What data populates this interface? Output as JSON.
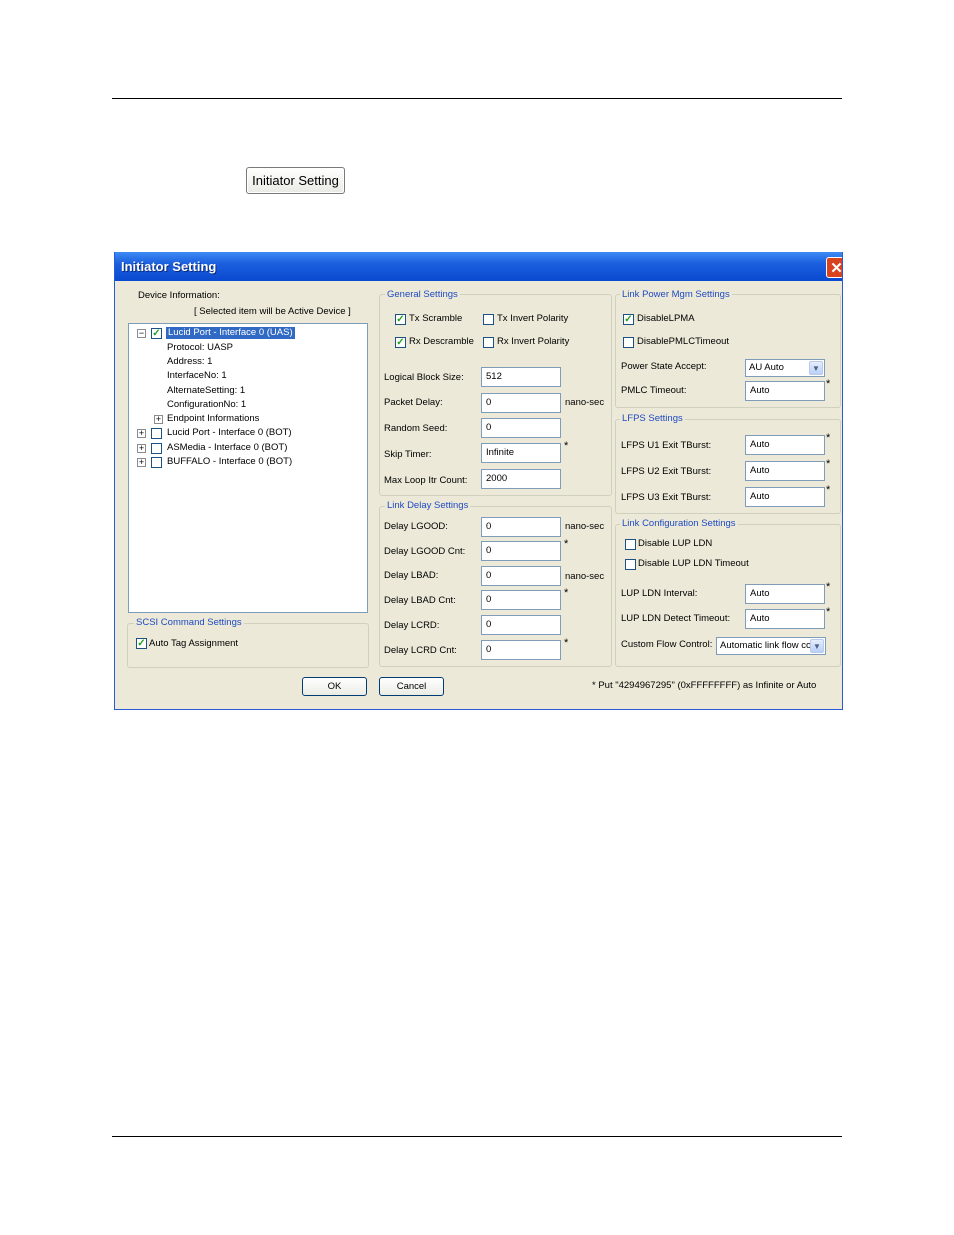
{
  "page_button": "Initiator Setting",
  "dialog": {
    "title": "Initiator Setting",
    "close_icon": "close-icon",
    "device_info": {
      "label": "Device Information:",
      "hint": "[ Selected item will be Active Device  ]",
      "tree": {
        "root": "Lucid Port - Interface 0 (UAS)",
        "children": [
          "Protocol: UASP",
          "Address: 1",
          "InterfaceNo: 1",
          "AlternateSetting: 1",
          "ConfigurationNo: 1",
          "Endpoint Informations"
        ],
        "others": [
          "Lucid Port - Interface 0 (BOT)",
          "ASMedia - Interface 0 (BOT)",
          "BUFFALO - Interface 0 (BOT)"
        ]
      }
    },
    "scsi": {
      "title": "SCSI Command Settings",
      "auto_tag": "Auto Tag Assignment"
    },
    "general": {
      "title": "General Settings",
      "tx_scramble": "Tx Scramble",
      "tx_invert": "Tx Invert Polarity",
      "rx_descramble": "Rx Descramble",
      "rx_invert": "Rx Invert Polarity",
      "logical_block_label": "Logical Block Size:",
      "logical_block_value": "512",
      "packet_delay_label": "Packet Delay:",
      "packet_delay_value": "0",
      "packet_delay_unit": "nano-sec",
      "random_seed_label": "Random Seed:",
      "random_seed_value": "0",
      "skip_timer_label": "Skip Timer:",
      "skip_timer_value": "Infinite",
      "max_loop_label": "Max Loop Itr Count:",
      "max_loop_value": "2000"
    },
    "link_delay": {
      "title": "Link Delay Settings",
      "lgood_label": "Delay LGOOD:",
      "lgood_value": "0",
      "lgood_unit": "nano-sec",
      "lgood_cnt_label": "Delay LGOOD Cnt:",
      "lgood_cnt_value": "0",
      "lbad_label": "Delay LBAD:",
      "lbad_value": "0",
      "lbad_unit": "nano-sec",
      "lbad_cnt_label": "Delay LBAD Cnt:",
      "lbad_cnt_value": "0",
      "lcrd_label": "Delay LCRD:",
      "lcrd_value": "0",
      "lcrd_cnt_label": "Delay LCRD Cnt:",
      "lcrd_cnt_value": "0"
    },
    "link_power": {
      "title": "Link Power Mgm Settings",
      "disable_lpma": "DisableLPMA",
      "disable_pmlc": "DisablePMLCTimeout",
      "power_state_label": "Power State Accept:",
      "power_state_value": "AU Auto",
      "pmlc_timeout_label": "PMLC Timeout:",
      "pmlc_timeout_value": "Auto"
    },
    "lfps": {
      "title": "LFPS Settings",
      "u1_label": "LFPS U1 Exit TBurst:",
      "u1_value": "Auto",
      "u2_label": "LFPS U2 Exit TBurst:",
      "u2_value": "Auto",
      "u3_label": "LFPS U3 Exit TBurst:",
      "u3_value": "Auto"
    },
    "link_config": {
      "title": "Link Configuration Settings",
      "disable_lup_ldn": "Disable LUP LDN",
      "disable_lup_ldn_timeout": "Disable LUP LDN Timeout",
      "interval_label": "LUP LDN Interval:",
      "interval_value": "Auto",
      "detect_label": "LUP LDN Detect Timeout:",
      "detect_value": "Auto",
      "flow_label": "Custom Flow Control:",
      "flow_value": "Automatic link flow co"
    },
    "ok": "OK",
    "cancel": "Cancel",
    "star": "*",
    "footnote": "*    Put \"4294967295\" (0xFFFFFFFF) as Infinite or Auto"
  }
}
